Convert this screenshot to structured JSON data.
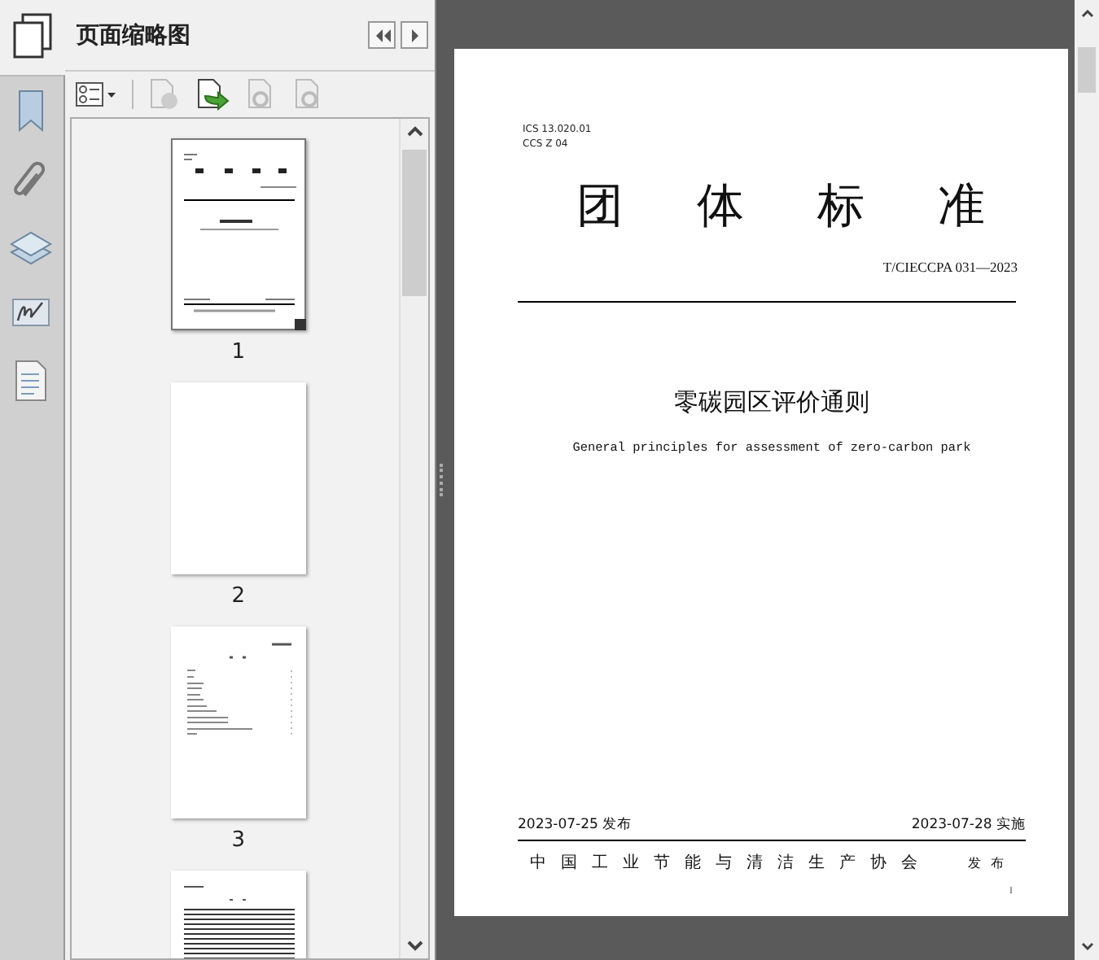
{
  "panel": {
    "title": "页面缩略图"
  },
  "thumbnails": [
    {
      "label": "1",
      "selected": true,
      "kind": "cover"
    },
    {
      "label": "2",
      "selected": false,
      "kind": "blank"
    },
    {
      "label": "3",
      "selected": false,
      "kind": "toc"
    },
    {
      "selected": false,
      "kind": "text"
    }
  ],
  "document": {
    "ics": "ICS 13.020.01",
    "ccs": "CCS Z 04",
    "heading": "团体标准",
    "code": "T/CIECCPA 031—2023",
    "title": "零碳园区评价通则",
    "subtitle": "General principles for assessment of zero-carbon park",
    "issue_date": "2023-07-25 发布",
    "effective_date": "2023-07-28 实施",
    "organization": "中国工业节能与清洁生产协会",
    "publish": "发布",
    "page_number": "I"
  }
}
